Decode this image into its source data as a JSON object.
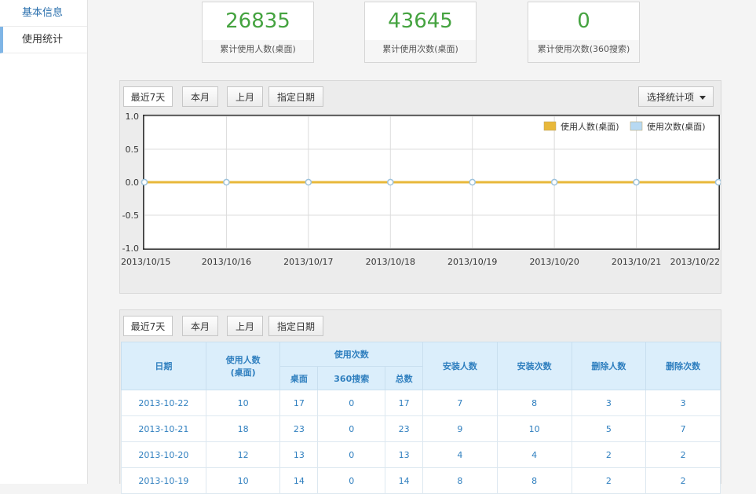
{
  "sidebar": {
    "items": [
      {
        "label": "基本信息"
      },
      {
        "label": "使用统计"
      }
    ]
  },
  "stats": [
    {
      "value": "26835",
      "label": "累计使用人数(桌面)"
    },
    {
      "value": "43645",
      "label": "累计使用次数(桌面)"
    },
    {
      "value": "0",
      "label": "累计使用次数(360搜索)"
    }
  ],
  "filters": {
    "last7": "最近7天",
    "this_month": "本月",
    "last_month": "上月",
    "custom_date": "指定日期",
    "select_stat": "选择统计项"
  },
  "colors": {
    "accent_green": "#45a340",
    "series_users": "#e8b83a",
    "series_visits": "#b7d9f2",
    "table_text": "#2f7fbf"
  },
  "chart_data": {
    "type": "line",
    "x": [
      "2013/10/15",
      "2013/10/16",
      "2013/10/17",
      "2013/10/18",
      "2013/10/19",
      "2013/10/20",
      "2013/10/21",
      "2013/10/22"
    ],
    "yticks": [
      "1.0",
      "0.5",
      "0.0",
      "-0.5",
      "-1.0"
    ],
    "ylim": [
      -1,
      1
    ],
    "grid": true,
    "legend_position": "top-right",
    "series": [
      {
        "name": "使用人数(桌面)",
        "color": "#e8b83a",
        "values": [
          0,
          0,
          0,
          0,
          0,
          0,
          0,
          0
        ]
      },
      {
        "name": "使用次数(桌面)",
        "color": "#b7d9f2",
        "values": [
          0,
          0,
          0,
          0,
          0,
          0,
          0,
          0
        ]
      }
    ]
  },
  "table": {
    "headers": {
      "date": "日期",
      "users_line1": "使用人数",
      "users_line2": "(桌面)",
      "visits": "使用次数",
      "visits_desktop": "桌面",
      "visits_360": "360搜索",
      "visits_total": "总数",
      "install_users": "安装人数",
      "install_count": "安装次数",
      "delete_users": "删除人数",
      "delete_count": "删除次数"
    },
    "rows": [
      {
        "date": "2013-10-22",
        "users": "10",
        "desktop": "17",
        "search360": "0",
        "total": "17",
        "install_users": "7",
        "install_count": "8",
        "delete_users": "3",
        "delete_count": "3"
      },
      {
        "date": "2013-10-21",
        "users": "18",
        "desktop": "23",
        "search360": "0",
        "total": "23",
        "install_users": "9",
        "install_count": "10",
        "delete_users": "5",
        "delete_count": "7"
      },
      {
        "date": "2013-10-20",
        "users": "12",
        "desktop": "13",
        "search360": "0",
        "total": "13",
        "install_users": "4",
        "install_count": "4",
        "delete_users": "2",
        "delete_count": "2"
      },
      {
        "date": "2013-10-19",
        "users": "10",
        "desktop": "14",
        "search360": "0",
        "total": "14",
        "install_users": "8",
        "install_count": "8",
        "delete_users": "2",
        "delete_count": "2"
      }
    ]
  }
}
